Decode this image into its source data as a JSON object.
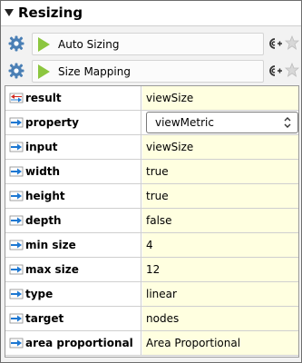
{
  "section": {
    "title": "Resizing"
  },
  "functions": [
    {
      "label": "Auto Sizing"
    },
    {
      "label": "Size Mapping"
    }
  ],
  "properties": [
    {
      "name": "result",
      "value": "viewSize",
      "icon": "output-arrow-icon"
    },
    {
      "name": "property",
      "value": "viewMetric",
      "icon": "input-arrow-icon",
      "control": "select"
    },
    {
      "name": "input",
      "value": "viewSize",
      "icon": "input-arrow-icon"
    },
    {
      "name": "width",
      "value": "true",
      "icon": "input-arrow-icon"
    },
    {
      "name": "height",
      "value": "true",
      "icon": "input-arrow-icon"
    },
    {
      "name": "depth",
      "value": "false",
      "icon": "input-arrow-icon"
    },
    {
      "name": "min size",
      "value": "4",
      "icon": "input-arrow-icon"
    },
    {
      "name": "max size",
      "value": "12",
      "icon": "input-arrow-icon"
    },
    {
      "name": "type",
      "value": "linear",
      "icon": "input-arrow-icon"
    },
    {
      "name": "target",
      "value": "nodes",
      "icon": "input-arrow-icon"
    },
    {
      "name": "area proportional",
      "value": "Area Proportional",
      "icon": "input-arrow-icon"
    }
  ],
  "colors": {
    "value_bg": "#ffffe0",
    "play_green": "#8cc63f",
    "arrow_blue": "#1e78d2",
    "arrow_red": "#d2281e"
  }
}
